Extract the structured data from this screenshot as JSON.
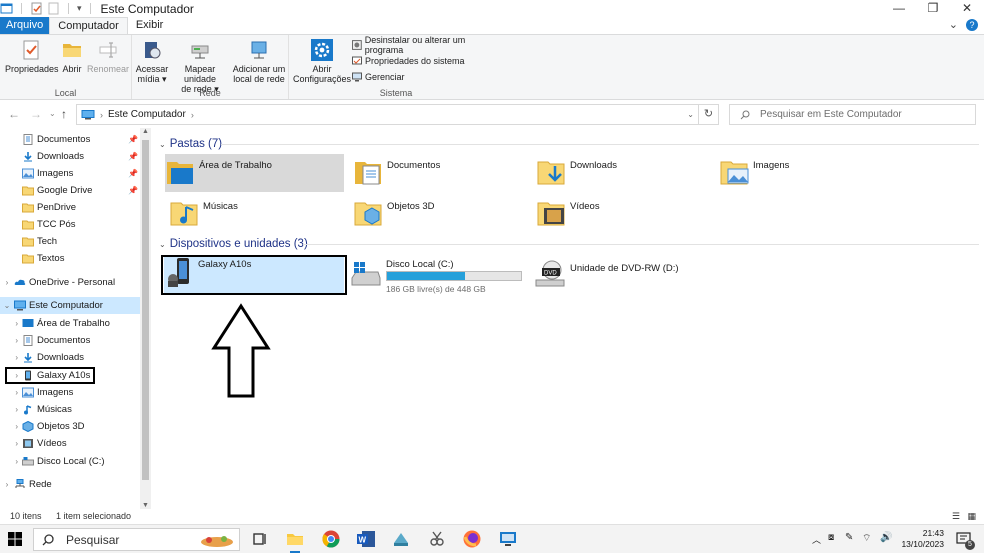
{
  "window": {
    "title": "Este Computador",
    "controls": {
      "minimize": "—",
      "maximize": "❐",
      "close": "✕"
    }
  },
  "ribbon_tabs": [
    "Arquivo",
    "Computador",
    "Exibir"
  ],
  "ribbon": {
    "groups": {
      "local": "Local",
      "rede": "Rede",
      "sistema": "Sistema"
    },
    "buttons": {
      "propriedades": "Propriedades",
      "abrir": "Abrir",
      "renomear": "Renomear",
      "acessar_midia": [
        "Acessar",
        "mídia ▾"
      ],
      "mapear_unidade": [
        "Mapear unidade",
        "de rede ▾"
      ],
      "adicionar_local": [
        "Adicionar um",
        "local de rede"
      ],
      "abrir_config": [
        "Abrir",
        "Configurações"
      ]
    },
    "small_buttons": {
      "desinstalar": "Desinstalar ou alterar um programa",
      "propriedades_sistema": "Propriedades do sistema",
      "gerenciar": "Gerenciar"
    }
  },
  "address": {
    "path": "Este Computador",
    "search_placeholder": "Pesquisar em Este Computador"
  },
  "nav": {
    "quick_access": [
      {
        "label": "Documentos",
        "pinned": true
      },
      {
        "label": "Downloads",
        "pinned": true
      },
      {
        "label": "Imagens",
        "pinned": true
      },
      {
        "label": "Google Drive",
        "pinned": true
      },
      {
        "label": "PenDrive",
        "pinned": false
      },
      {
        "label": "TCC Pós",
        "pinned": false
      },
      {
        "label": "Tech",
        "pinned": false
      },
      {
        "label": "Textos",
        "pinned": false
      }
    ],
    "onedrive": "OneDrive - Personal",
    "this_pc": "Este Computador",
    "this_pc_children": [
      "Área de Trabalho",
      "Documentos",
      "Downloads",
      "Galaxy A10s",
      "Imagens",
      "Músicas",
      "Objetos 3D",
      "Vídeos",
      "Disco Local (C:)"
    ],
    "network": "Rede"
  },
  "content": {
    "folders_header": "Pastas (7)",
    "folders": [
      "Área de Trabalho",
      "Documentos",
      "Downloads",
      "Imagens",
      "Músicas",
      "Objetos 3D",
      "Vídeos"
    ],
    "devices_header": "Dispositivos e unidades (3)",
    "devices": {
      "phone": "Galaxy A10s",
      "disk_label": "Disco Local (C:)",
      "disk_free": "186 GB livre(s) de 448 GB",
      "disk_used_fraction": 0.585,
      "dvd_label": "Unidade de DVD-RW (D:)"
    }
  },
  "status": {
    "items": "10 itens",
    "selected": "1 item selecionado"
  },
  "taskbar": {
    "search_placeholder": "Pesquisar",
    "time": "21:43",
    "date": "13/10/2023",
    "notification_count": "5"
  },
  "colors": {
    "accent": "#1979ca",
    "selection": "#cce8ff",
    "hover": "#d9d9d9",
    "disk_bar": "#26a0da",
    "folder": "#f8d775"
  }
}
